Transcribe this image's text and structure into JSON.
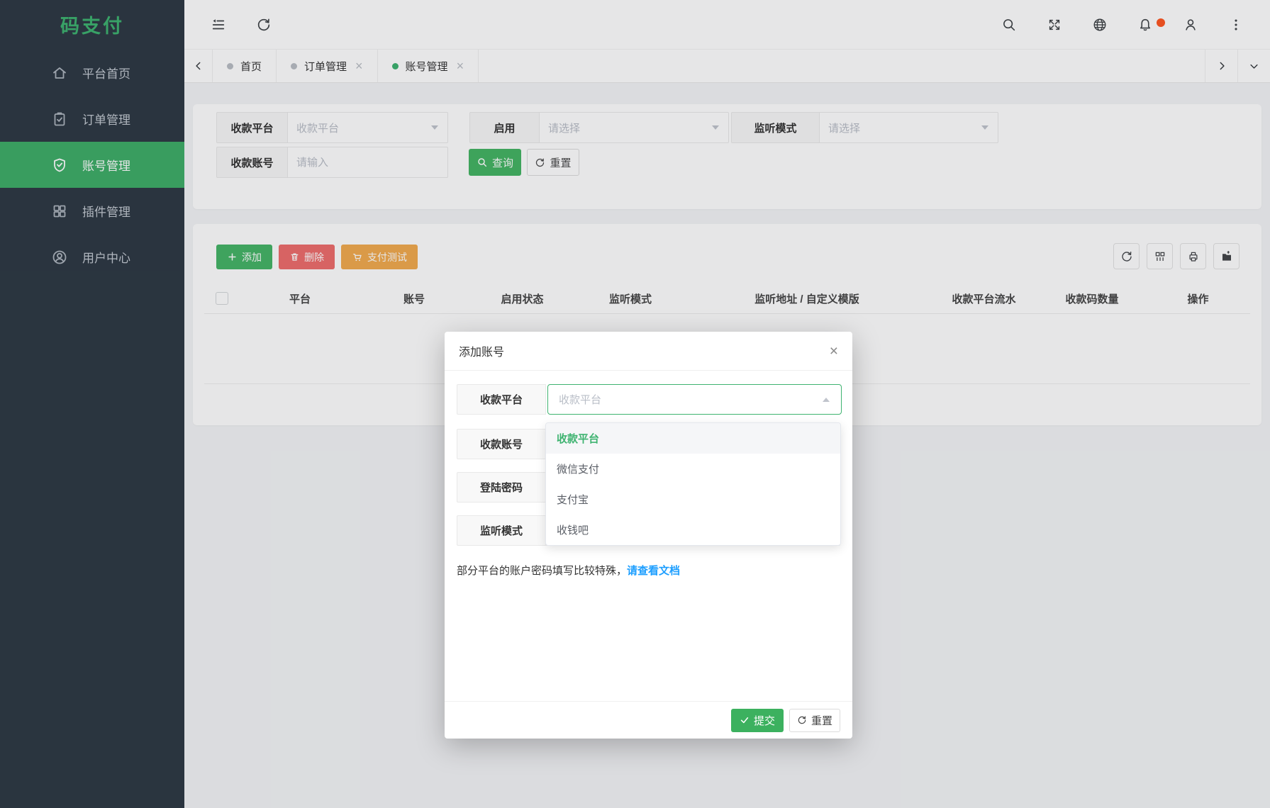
{
  "colors": {
    "accent_green": "#3eb370",
    "submit_green": "#3cb15f",
    "danger_red": "#ef6e6c",
    "warning_orange": "#f2ab4f",
    "link_blue": "#1e9fff",
    "notification_dot": "#ff5722",
    "sidebar_bg": "#2e3944"
  },
  "sidebar": {
    "logo": "码支付",
    "items": [
      {
        "label": "平台首页",
        "icon": "home-icon",
        "active": false
      },
      {
        "label": "订单管理",
        "icon": "order-icon",
        "active": false
      },
      {
        "label": "账号管理",
        "icon": "account-shield-icon",
        "active": true
      },
      {
        "label": "插件管理",
        "icon": "plugin-icon",
        "active": false
      },
      {
        "label": "用户中心",
        "icon": "user-icon",
        "active": false
      }
    ]
  },
  "topbar": {
    "left_icons": [
      "collapse-menu-icon",
      "refresh-icon"
    ],
    "right_icons": [
      "search-icon",
      "fullscreen-icon",
      "globe-icon",
      "bell-icon",
      "profile-icon",
      "more-icon"
    ],
    "has_notification": true
  },
  "tabbar": {
    "tabs": [
      {
        "label": "首页",
        "closable": false,
        "active": false
      },
      {
        "label": "订单管理",
        "closable": true,
        "active": false
      },
      {
        "label": "账号管理",
        "closable": true,
        "active": true
      }
    ]
  },
  "filter": {
    "fields": {
      "platform": {
        "label": "收款平台",
        "placeholder": "收款平台"
      },
      "enabled": {
        "label": "启用",
        "placeholder": "请选择"
      },
      "listen_mode": {
        "label": "监听模式",
        "placeholder": "请选择"
      },
      "account": {
        "label": "收款账号",
        "placeholder": "请输入"
      }
    },
    "query_label": "查询",
    "reset_label": "重置"
  },
  "table": {
    "actions": {
      "add": "添加",
      "delete": "删除",
      "pay_test": "支付测试"
    },
    "columns": [
      "平台",
      "账号",
      "启用状态",
      "监听模式",
      "监听地址 / 自定义模版",
      "收款平台流水",
      "收款码数量",
      "操作"
    ]
  },
  "modal": {
    "title": "添加账号",
    "fields": [
      {
        "label": "收款平台",
        "placeholder": "收款平台"
      },
      {
        "label": "收款账号"
      },
      {
        "label": "登陆密码"
      },
      {
        "label": "监听模式"
      }
    ],
    "dropdown": {
      "options": [
        {
          "label": "收款平台",
          "selected": true
        },
        {
          "label": "微信支付",
          "selected": false
        },
        {
          "label": "支付宝",
          "selected": false
        },
        {
          "label": "收钱吧",
          "selected": false
        }
      ]
    },
    "note": {
      "text": "部分平台的账户密码填写比较特殊，",
      "link": "请查看文档"
    },
    "submit_label": "提交",
    "reset_label": "重置"
  }
}
